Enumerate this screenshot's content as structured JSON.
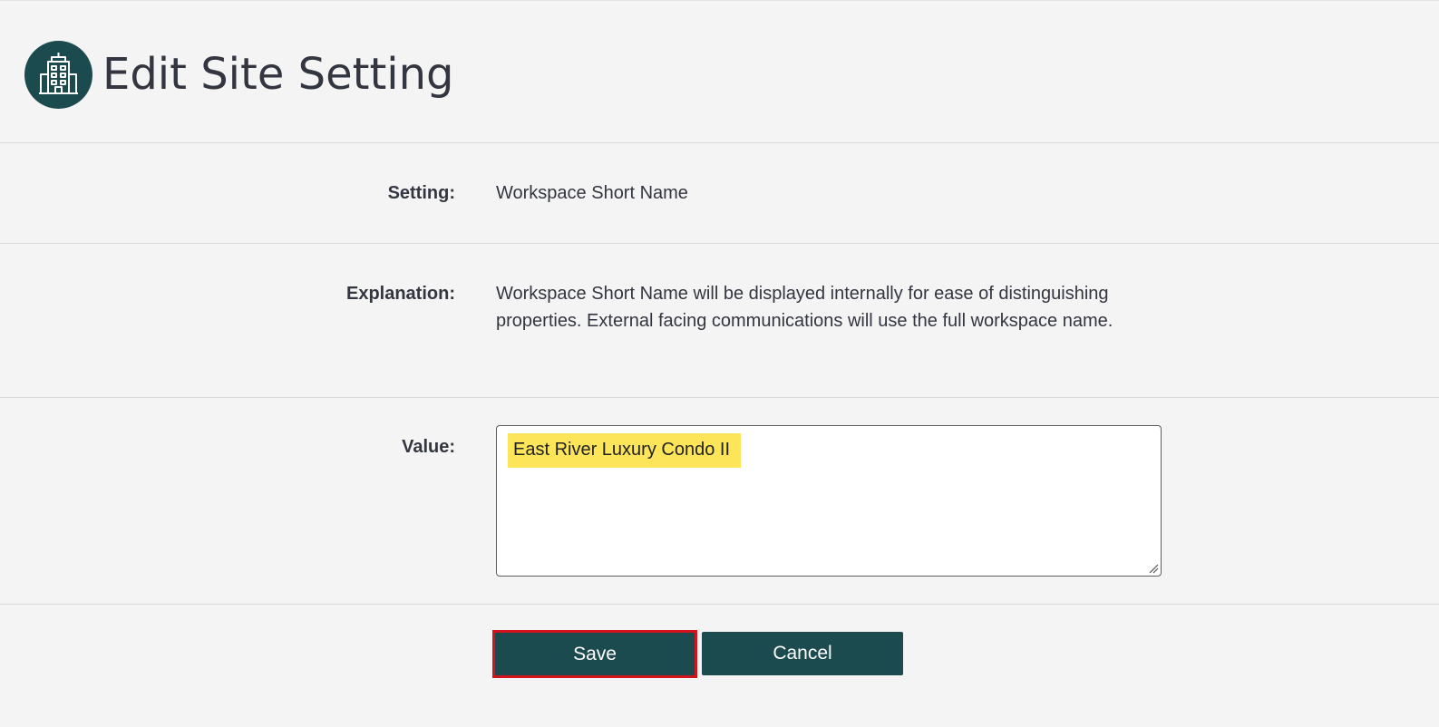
{
  "header": {
    "title": "Edit Site Setting",
    "icon": "building-icon",
    "icon_bg_color": "#1c4b4f"
  },
  "form": {
    "setting": {
      "label": "Setting:",
      "value": "Workspace Short Name"
    },
    "explanation": {
      "label": "Explanation:",
      "value": "Workspace Short Name will be displayed internally for ease of distinguishing properties. External facing communications will use the full workspace name."
    },
    "value_field": {
      "label": "Value:",
      "value": "East River Luxury Condo II",
      "highlight_color": "#fde55a"
    }
  },
  "actions": {
    "save_label": "Save",
    "cancel_label": "Cancel",
    "button_color": "#1c4b4f",
    "save_outline_color": "#d3141b"
  }
}
